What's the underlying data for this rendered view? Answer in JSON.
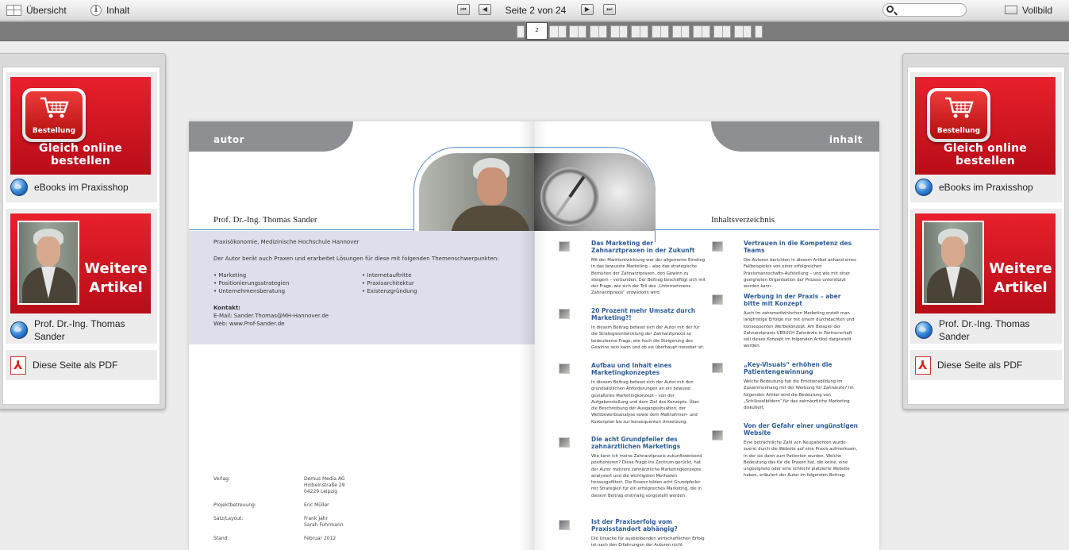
{
  "toolbar": {
    "overview_label": "Übersicht",
    "contents_label": "Inhalt",
    "page_indicator": "Seite 2 von 24",
    "search_value": "",
    "fullscreen_label": "Vollbild",
    "first_glyph": "⏮",
    "prev_glyph": "◀",
    "next_glyph": "▶",
    "last_glyph": "⏭"
  },
  "thumbnails": {
    "current_label": "2"
  },
  "side_panel": {
    "order_badge": "Bestellung",
    "order_cta": "Gleich online bestellen",
    "shop_link": "eBooks im Praxisshop",
    "articles_line1": "Weitere",
    "articles_line2": "Artikel",
    "author_link": "Prof. Dr.-Ing.  Thomas Sander",
    "pdf_link": "Diese Seite als PDF"
  },
  "spread": {
    "left_tab": "autor",
    "right_tab": "inhalt",
    "author_name": "Prof. Dr.-Ing. Thomas Sander",
    "toc_heading": "Inhaltsverzeichnis",
    "author_box": {
      "affiliation": "Praxisökonomie, Medizinische Hochschule Hannover",
      "intro": "Der Autor berät auch Praxen und erarbeitet Lösungen für diese mit folgenden Themenschwerpunkten:",
      "topics_left": [
        "• Marketing",
        "• Positionierungsstrategien",
        "• Unternehmensberatung"
      ],
      "topics_right": [
        "• Internetauftritte",
        "• Praxisarchitektur",
        "• Existenzgründung"
      ],
      "contact_label": "Kontakt:",
      "email": "E-Mail: Sander.Thomas@MH-Hannover.de",
      "web": "Web: www.Prof-Sander.de"
    },
    "imprint": [
      {
        "k": "Verlag:",
        "v": [
          "Demus Media AG",
          "Holbeinstraße 29",
          "04229 Leipzig"
        ]
      },
      {
        "k": "Projektbetreuung:",
        "v": [
          "Eric Müller"
        ]
      },
      {
        "k": "Satz/Layout:",
        "v": [
          "Frank Jahr",
          "Sarah Fuhrmann"
        ]
      },
      {
        "k": "Stand:",
        "v": [
          "Februar 2012"
        ]
      }
    ],
    "articles_left": [
      {
        "title": "Das Marketing der Zahnarztpraxen in der Zukunft",
        "desc": "Mit der Marktentwicklung war der allgemeine Einstieg in das bewusste Marketing – also das strategische Bemühen der Zahnarztpraxen, den Gewinn zu steigern – verbunden. Der Beitrag beschäftigt sich mit der Frage, wie sich der Teil des „Unternehmens Zahnarztpraxis“ entwickeln wird."
      },
      {
        "title": "20 Prozent mehr Umsatz durch Marketing?!",
        "desc": "In diesem Beitrag befasst sich der Autor mit der für die Strategieentwicklung der Zahnarztpraxis so bedeutsame Frage, wie hoch die Steigerung des Gewinns sein kann und ob sie überhaupt messbar ist."
      },
      {
        "title": "Aufbau und Inhalt eines Marketingkonzeptes",
        "desc": "In diesem Beitrag befasst sich der Autor mit den grundsätzlichen Anforderungen an ein bewusst gestaltetes Marketingkonzept – von der Aufgabenstellung und dem Ziel des Konzepts. Über die Beschreibung der Ausgangssituation, der Wettbewerbsanalyse sowie dem Maßnahmen- und Kostenplan bis zur konsequenten Umsetzung."
      },
      {
        "title": "Die acht Grundpfeiler des zahnärztlichen Marketings",
        "desc": "Wie kann ich meine Zahnarztpraxis zukunftsweisend positionieren? Diese Frage ins Zentrum gerückt, hat der Autor mehrere zahnärztliche Marketingkonzepte analysiert und die wichtigsten Methoden herausgefiltert. Die Essenz bilden acht Grundpfeiler mit Strategien für ein erfolgreiches Marketing, die in diesem Beitrag erstmalig vorgestellt werden."
      },
      {
        "title": "Ist der Praxiserfolg vom Praxisstandort abhängig?",
        "desc": "Die Ursache für ausbleibenden wirtschaftlichen Erfolg ist nach den Erfahrungen der Autoren nicht"
      }
    ],
    "articles_right": [
      {
        "title": "Vertrauen in die Kompetenz des Teams",
        "desc": "Die Autoren berichten in diesem Artikel anhand eines Fallbeispieles von einer erfolgreichen Praxismannschafts-Aufstellung – und wie mit einer geeigneten Organisation der Prozess unterstützt werden kann."
      },
      {
        "title": "Werbung in der Praxis – aber bitte mit Konzept",
        "desc": "Auch im zahnmedizinischen Marketing erzielt man langfristige Erfolge nur mit einem durchdachten und konsequenten Werbekonzept. Am Beispiel der Zahnarztpraxis UERUCH Zahnärzte in Partnerschaft soll dieses Konzept im folgenden Artikel dargestellt werden."
      },
      {
        "title": "„Key-Visuals“ erhöhen die Patientengewinnung",
        "desc": "Welche Bedeutung hat die Emotionsbildung im Zusammenhang mit der Werbung für Zahnärzte? Im folgenden Artikel wird die Bedeutung von „Schlüsselbildern“ für das zahnärztliche Marketing diskutiert."
      },
      {
        "title": "Von der Gefahr einer ungünstigen Website",
        "desc": "Eine beträchtliche Zahl von Neupatienten wurde zuerst durch die Website auf eine Praxis aufmerksam, in der sie dann zum Patienten wurden. Welche Bedeutung das für die Praxen hat, die keine, eine ungeeignete oder eine schlecht platzierte Website haben, erläutert der Autor im folgenden Beitrag."
      }
    ]
  }
}
